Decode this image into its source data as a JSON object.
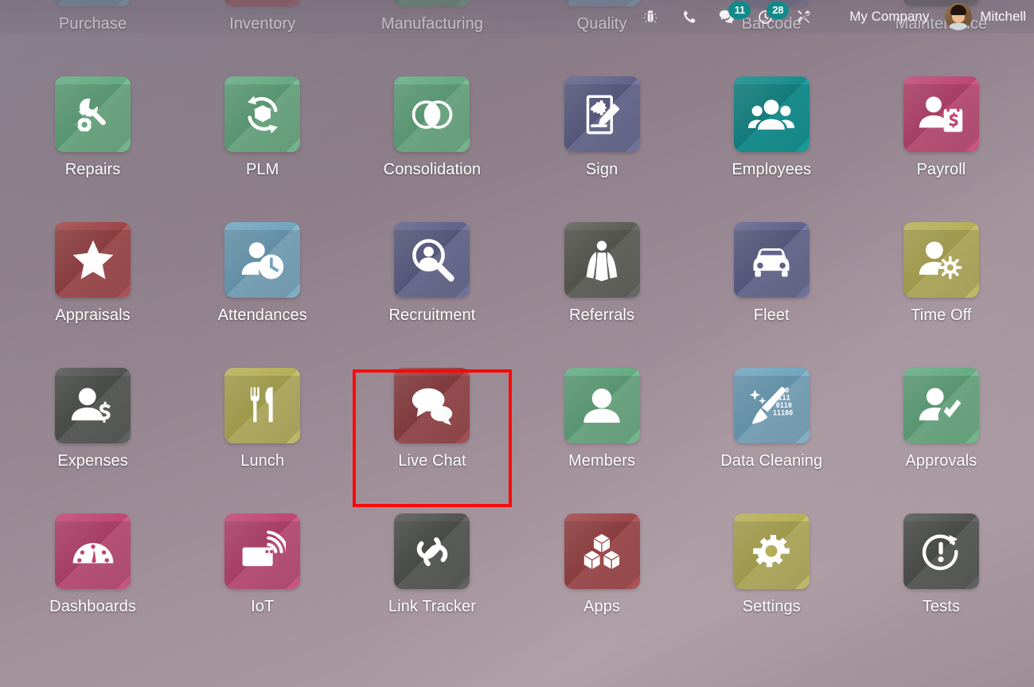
{
  "topbar": {
    "icons": [
      {
        "name": "bug-icon",
        "label": "Debug",
        "badge": null
      },
      {
        "name": "phone-icon",
        "label": "VoIP",
        "badge": null
      },
      {
        "name": "chat-bubble-icon",
        "label": "Messages",
        "badge": "11"
      },
      {
        "name": "activity-clock-icon",
        "label": "Activities",
        "badge": "28"
      },
      {
        "name": "tools-icon",
        "label": "Developer Tools",
        "badge": null
      }
    ],
    "company": "My Company",
    "username": "Mitchell"
  },
  "apps": [
    {
      "label": "Purchase",
      "icon": "purchase-icon",
      "color": "#5b8ba4",
      "accent": "#74a2ba"
    },
    {
      "label": "Inventory",
      "icon": "inventory-icon",
      "color": "#8f3f42",
      "accent": "#a75356"
    },
    {
      "label": "Manufacturing",
      "icon": "manufacturing-icon",
      "color": "#4b8a62",
      "accent": "#61a079"
    },
    {
      "label": "Quality",
      "icon": "quality-icon",
      "color": "#5b8ba4",
      "accent": "#79a8c0"
    },
    {
      "label": "Barcode",
      "icon": "barcode-icon",
      "color": "#5a5f87",
      "accent": "#70759c"
    },
    {
      "label": "Maintenance",
      "icon": "maintenance-icon",
      "color": "#4c4c4c",
      "accent": "#5f5f5f"
    },
    {
      "label": "Repairs",
      "icon": "repairs-icon",
      "color": "#63a97f",
      "accent": "#79bb92"
    },
    {
      "label": "PLM",
      "icon": "plm-icon",
      "color": "#63a97f",
      "accent": "#79bb92"
    },
    {
      "label": "Consolidation",
      "icon": "consolidation-icon",
      "color": "#63a97f",
      "accent": "#79bb92"
    },
    {
      "label": "Sign",
      "icon": "sign-icon",
      "color": "#5e6089",
      "accent": "#7577a0"
    },
    {
      "label": "Employees",
      "icon": "employees-icon",
      "color": "#128a8a",
      "accent": "#19a0a0"
    },
    {
      "label": "Payroll",
      "icon": "payroll-icon",
      "color": "#bd4470",
      "accent": "#cf5a84"
    },
    {
      "label": "Appraisals",
      "icon": "appraisals-icon",
      "color": "#9c4345",
      "accent": "#b15659"
    },
    {
      "label": "Attendances",
      "icon": "attendances-icon",
      "color": "#6fa3bd",
      "accent": "#87b6ce"
    },
    {
      "label": "Recruitment",
      "icon": "recruitment-icon",
      "color": "#5e6089",
      "accent": "#7577a0"
    },
    {
      "label": "Referrals",
      "icon": "referrals-icon",
      "color": "#5a5c54",
      "accent": "#6c6e66"
    },
    {
      "label": "Fleet",
      "icon": "fleet-icon",
      "color": "#5e6089",
      "accent": "#7577a0"
    },
    {
      "label": "Time Off",
      "icon": "timeoff-icon",
      "color": "#b4ad55",
      "accent": "#c6bf6b"
    },
    {
      "label": "Expenses",
      "icon": "expenses-icon",
      "color": "#4f524f",
      "accent": "#636663"
    },
    {
      "label": "Lunch",
      "icon": "lunch-icon",
      "color": "#b4ad55",
      "accent": "#c6bf6b"
    },
    {
      "label": "Live Chat",
      "icon": "live-chat-icon",
      "color": "#8f3f42",
      "accent": "#a75356",
      "highlighted": true
    },
    {
      "label": "Members",
      "icon": "members-icon",
      "color": "#63a97f",
      "accent": "#79bb92"
    },
    {
      "label": "Data Cleaning",
      "icon": "data-cleaning-icon",
      "color": "#6fa3bd",
      "accent": "#87b6ce"
    },
    {
      "label": "Approvals",
      "icon": "approvals-icon",
      "color": "#63a97f",
      "accent": "#79bb92"
    },
    {
      "label": "Dashboards",
      "icon": "dashboards-icon",
      "color": "#bd4470",
      "accent": "#cf5a84"
    },
    {
      "label": "IoT",
      "icon": "iot-icon",
      "color": "#bd4470",
      "accent": "#cf5a84"
    },
    {
      "label": "Link Tracker",
      "icon": "link-tracker-icon",
      "color": "#4f524f",
      "accent": "#636663"
    },
    {
      "label": "Apps",
      "icon": "apps-icon",
      "color": "#9c4345",
      "accent": "#b15659"
    },
    {
      "label": "Settings",
      "icon": "settings-icon",
      "color": "#b4ad55",
      "accent": "#c6bf6b"
    },
    {
      "label": "Tests",
      "icon": "tests-icon",
      "color": "#4f524f",
      "accent": "#636663"
    }
  ],
  "data_cleaning_binary": [
    "00",
    "111",
    "0110",
    "11100"
  ],
  "highlight": {
    "color": "#fb0a0a",
    "target": "Live Chat"
  }
}
